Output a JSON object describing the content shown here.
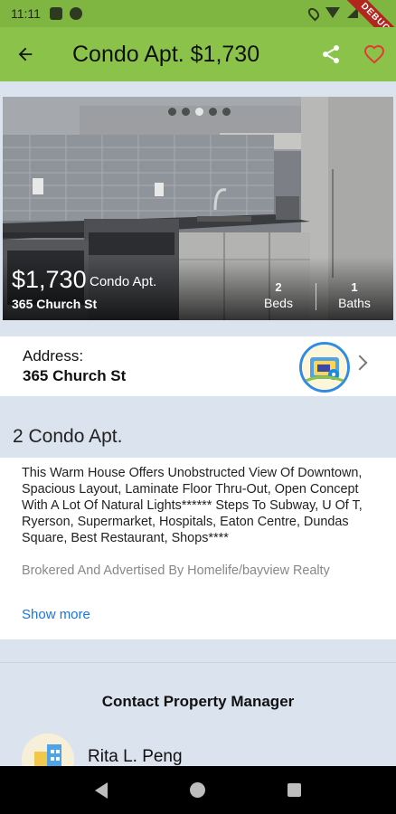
{
  "status_bar": {
    "time": "11:11",
    "debug_label": "DEBUG"
  },
  "app_bar": {
    "title": "Condo Apt. $1,730",
    "background": "#8bc34a",
    "icons": [
      "arrow-back-icon",
      "share-icon",
      "heart-outline-icon"
    ]
  },
  "listing": {
    "price": "$1,730",
    "type": "Condo Apt.",
    "address": "365 Church St",
    "beds_value": "2",
    "beds_label": "Beds",
    "baths_value": "1",
    "baths_label": "Baths",
    "carousel": {
      "total_dots": 5,
      "active_index": 2
    }
  },
  "address_section": {
    "label": "Address:",
    "value": "365 Church St"
  },
  "description_section": {
    "title": "2 Condo Apt.",
    "text": "This Warm House Offers Unobstructed View Of Downtown, Spacious Layout, Laminate Floor Thru-Out, Open Concept With A Lot Of Natural Lights****** Steps To Subway, U Of T, Ryerson, Supermarket, Hospitals, Eaton Centre, Dundas Square, Best Restaurant, Shops****",
    "faded_text": "Brokered And Advertised By Homelife/bayview Realty",
    "show_more": "Show more"
  },
  "contact_section": {
    "title": "Contact Property Manager",
    "manager_name": "Rita L. Peng"
  },
  "colors": {
    "accent_green": "#8bc34a",
    "link_blue": "#1a73e8",
    "heart_red": "#e53935",
    "page_bg": "#dbe3ef"
  }
}
